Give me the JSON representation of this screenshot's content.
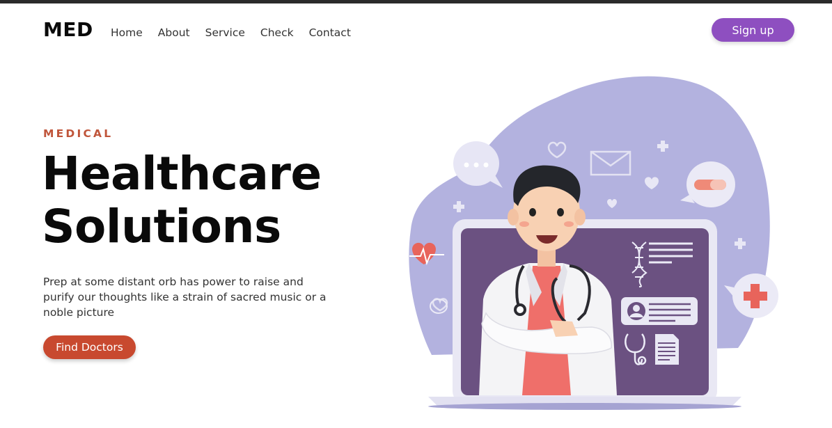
{
  "brand": {
    "logo": "MED"
  },
  "nav": {
    "items": [
      "Home",
      "About",
      "Service",
      "Check",
      "Contact"
    ]
  },
  "header": {
    "signup_label": "Sign up"
  },
  "hero": {
    "eyebrow": "MEDICAL",
    "title_line1": "Healthcare",
    "title_line2": "Solutions",
    "description": "Prep at some distant orb has power to raise and purify our thoughts like a strain of sacred music or a noble picture",
    "cta_label": "Find Doctors"
  },
  "colors": {
    "accent_purple": "#8e4fc0",
    "accent_red": "#c8492f",
    "eyebrow": "#c0553a",
    "blob": "#b3b2df",
    "screen": "#6b5181"
  },
  "illustration": {
    "icons": [
      "chat-bubble-icon",
      "pill-icon",
      "heart-rate-icon",
      "medical-cross-icon",
      "envelope-icon",
      "dna-icon",
      "id-card-icon",
      "stethoscope-icon",
      "document-icon"
    ]
  }
}
